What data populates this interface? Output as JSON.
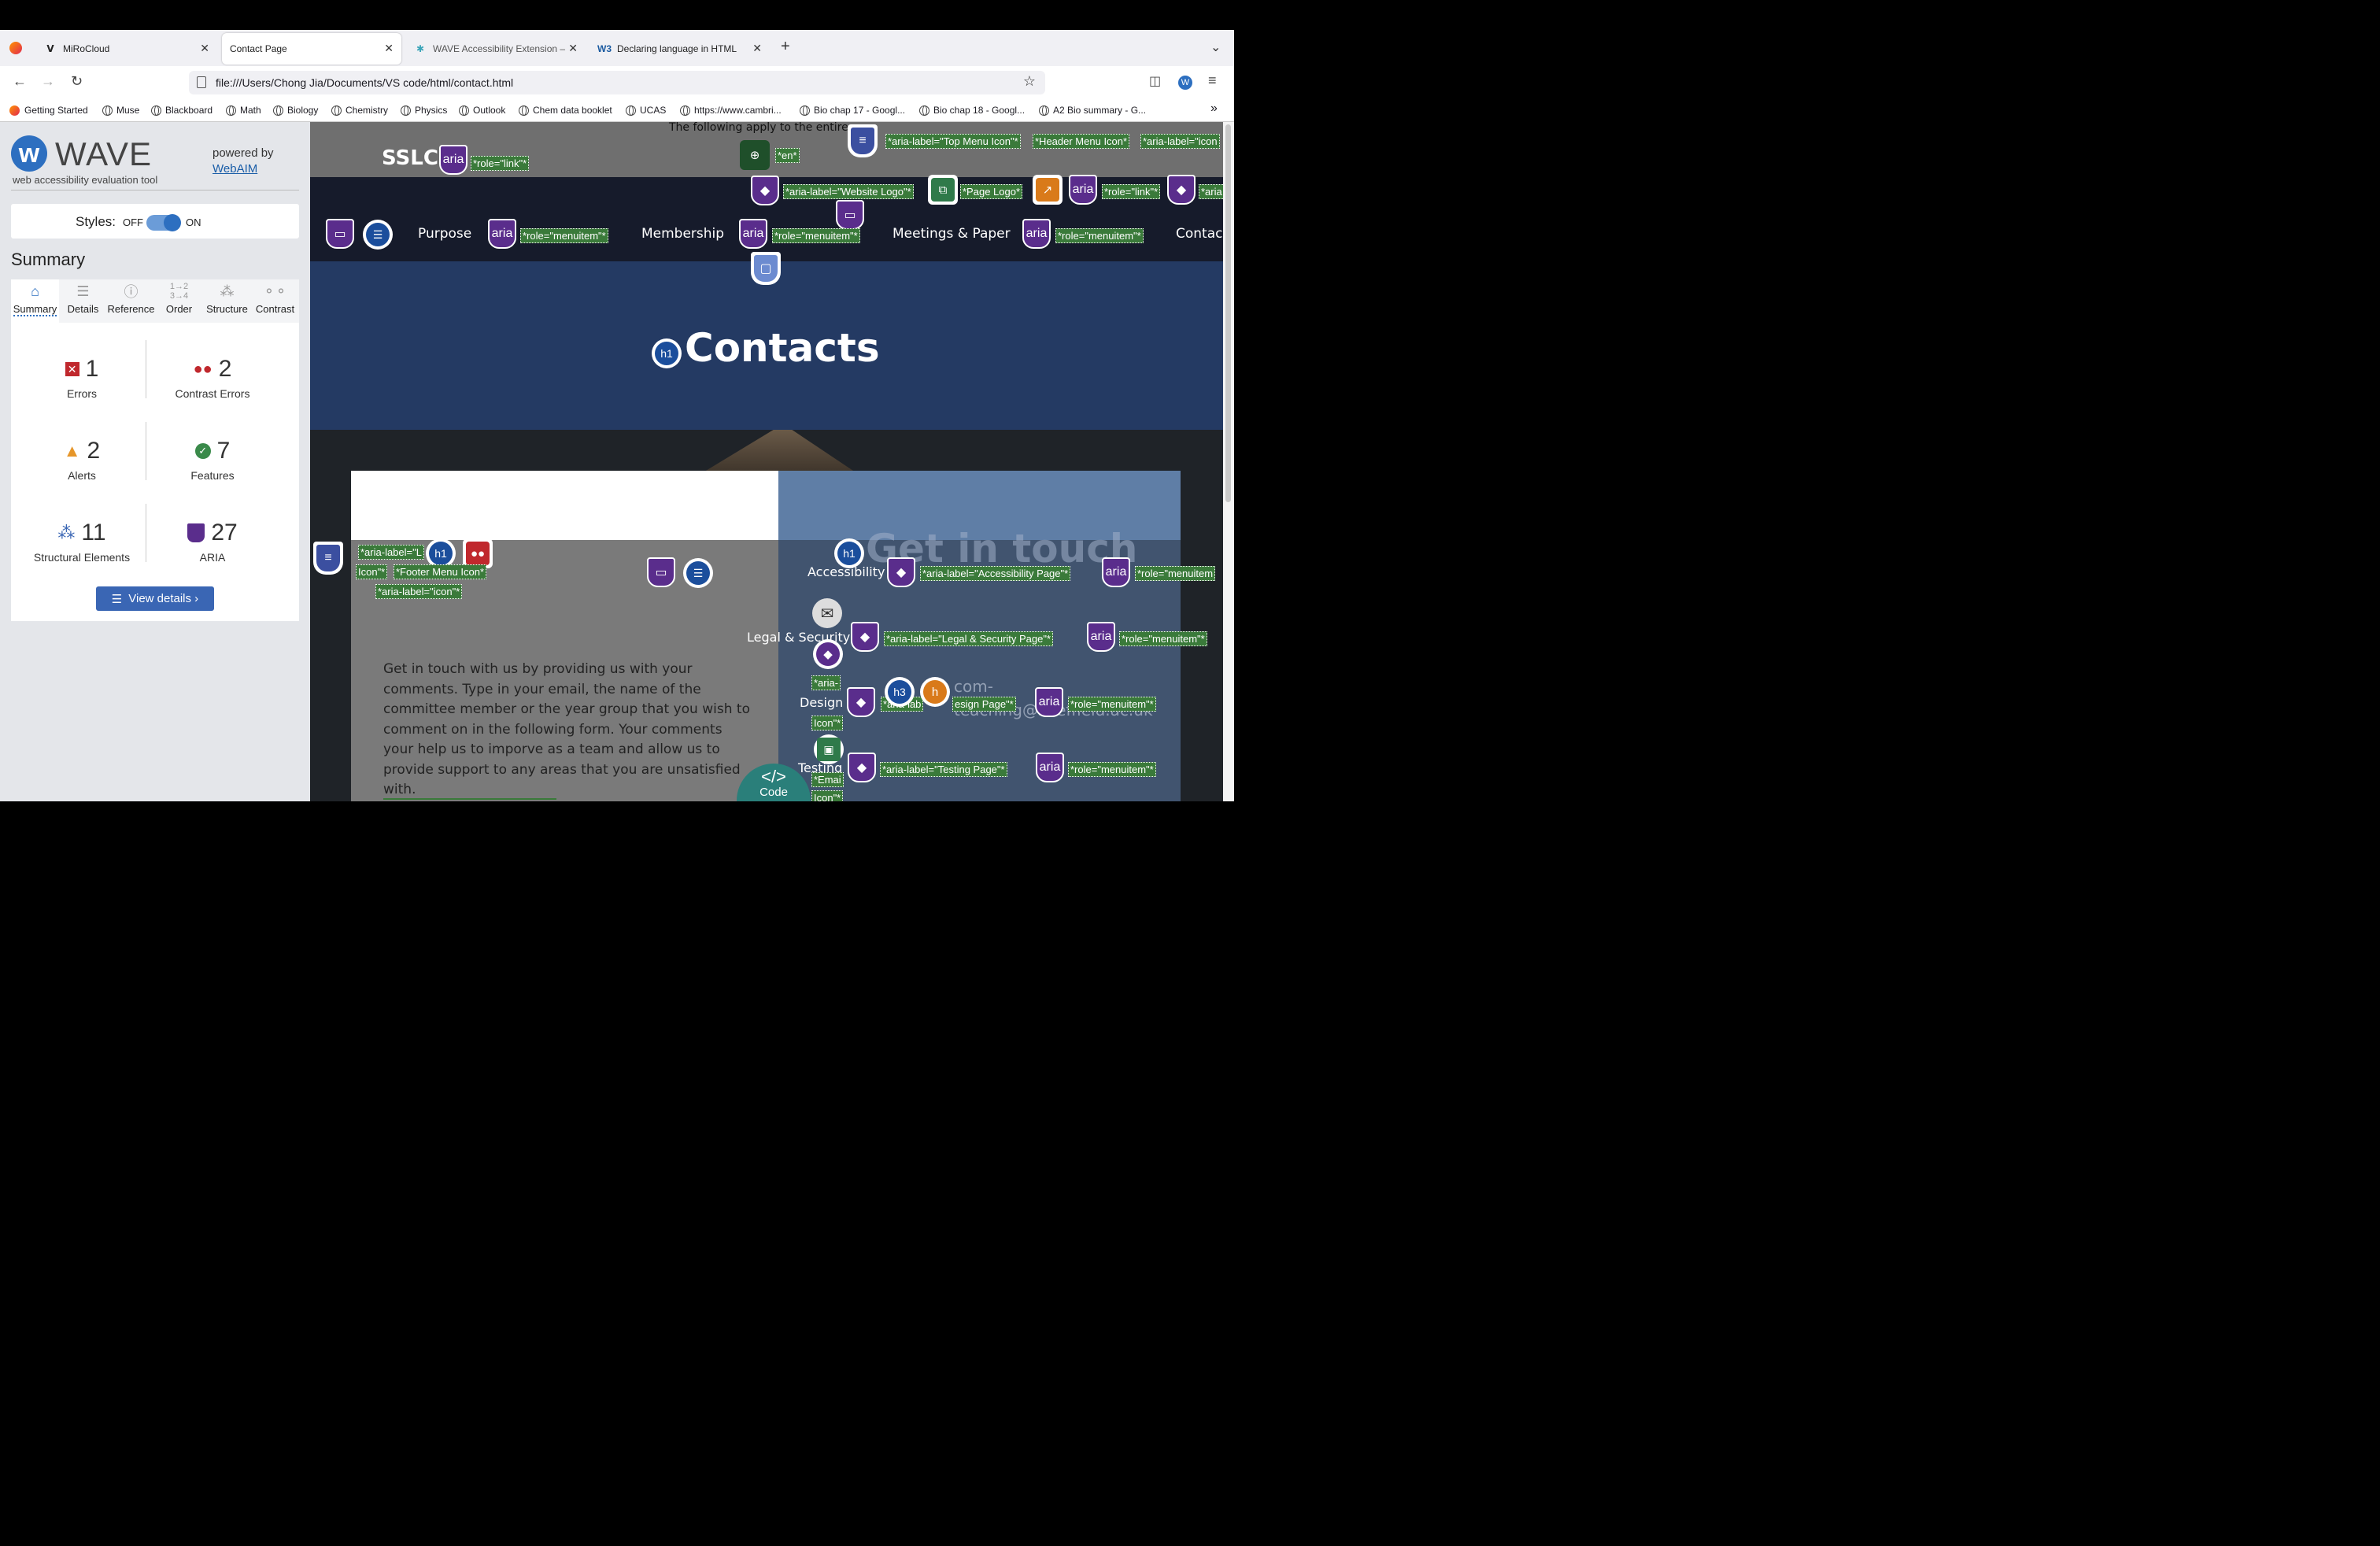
{
  "browser": {
    "tabs": [
      {
        "label": "MiRoCloud",
        "icon": "mirocloud-icon"
      },
      {
        "label": "Contact Page",
        "icon": "none",
        "active": true
      },
      {
        "label": "WAVE Accessibility Extension –",
        "icon": "puzzle-icon"
      },
      {
        "label": "Declaring language in HTML",
        "icon": "w3c-icon"
      }
    ],
    "url": "file:///Users/Chong Jia/Documents/VS code/html/contact.html",
    "bookmarks": [
      "Getting Started",
      "Muse",
      "Blackboard",
      "Math",
      "Biology",
      "Chemistry",
      "Physics",
      "Outlook",
      "Chem data booklet",
      "UCAS",
      "https://www.cambri...",
      "Bio chap 17 - Googl...",
      "Bio chap 18 - Googl...",
      "A2 Bio summary - G..."
    ]
  },
  "wave": {
    "title": "WAVE",
    "subtitle": "web accessibility evaluation tool",
    "powered": "powered by",
    "webaim": "WebAIM",
    "styles_label": "Styles:",
    "off": "OFF",
    "on": "ON",
    "summary_heading": "Summary",
    "tabs": [
      "Summary",
      "Details",
      "Reference",
      "Order",
      "Structure",
      "Contrast"
    ],
    "stats": {
      "errors": {
        "num": "1",
        "label": "Errors"
      },
      "contrast": {
        "num": "2",
        "label": "Contrast Errors"
      },
      "alerts": {
        "num": "2",
        "label": "Alerts"
      },
      "features": {
        "num": "7",
        "label": "Features"
      },
      "structural": {
        "num": "11",
        "label": "Structural Elements"
      },
      "aria": {
        "num": "27",
        "label": "ARIA"
      }
    },
    "view_details": "View details ›"
  },
  "page": {
    "apply_text": "The following apply to the entire pa",
    "logo": "SSLC",
    "nav": [
      "Purpose",
      "Membership",
      "Meetings & Paper",
      "Contac"
    ],
    "hero_title": "Contacts",
    "get_in_touch": "Get in touch",
    "side_links": [
      "Accessibility",
      "Legal & Security",
      "Design",
      "Testing"
    ],
    "email_partial_1": "com-",
    "email_partial_2": "teaching@sheffield.ac.uk",
    "paragraph": "Get in touch with us by providing us with your comments. Type in your email, the name of the committee member or the year group that you wish to comment on in the following form. Your comments your help us to imporve as a team and allow us to provide support to any areas that you are unsatisfied with.",
    "code_label": "Code",
    "code_glyph": "</>"
  },
  "labels": {
    "role_link": "*role=\"link\"*",
    "lang_en": "*en*",
    "top_menu": "*aria-label=\"Top Menu Icon\"*",
    "header_menu": "*Header Menu Icon*",
    "aria_icon_trunc": "*aria-label=\"icon",
    "website_logo": "*aria-label=\"Website Logo\"*",
    "page_logo": "*Page Logo*",
    "role_link2": "*role=\"link\"*",
    "aria_trunc": "*aria",
    "role_menuitem": "*role=\"menuitem\"*",
    "footer_1": "*aria-label=\"L",
    "footer_2": "Icon\"*",
    "footer_3": "*Footer Menu Icon*",
    "footer_4": "*aria-label=\"icon\"*",
    "access_page": "*aria-label=\"Accessibility Page\"*",
    "role_menuitem_trunc": "*role=\"menuitem",
    "legal_page": "*aria-label=\"Legal & Security Page\"*",
    "aria_dash": "*aria-",
    "icon_q": "Icon\"*",
    "design_page": "esign Page\"*",
    "design_label_partial": "*aria-lab",
    "testing_page": "*aria-label=\"Testing Page\"*",
    "email_1": "*Emai",
    "email_2": "Icon\"*",
    "aria_text": "aria",
    "h1": "h1",
    "h3": "h3"
  }
}
